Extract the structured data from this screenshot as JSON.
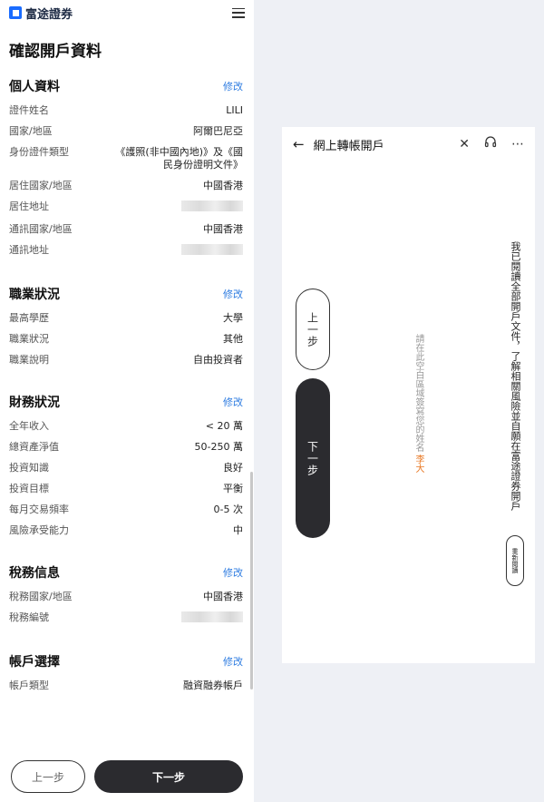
{
  "brand": {
    "logo_text": "富途證券"
  },
  "page_title": "確認開戶資料",
  "sections": [
    {
      "title": "個人資料",
      "edit": "修改",
      "rows": [
        {
          "k": "證件姓名",
          "v": "LILI"
        },
        {
          "k": "國家/地區",
          "v": "阿爾巴尼亞"
        },
        {
          "k": "身份證件類型",
          "v": "《護照(非中國內地)》及《國民身份證明文件》"
        },
        {
          "k": "居住國家/地區",
          "v": "中國香港"
        },
        {
          "k": "居住地址",
          "v": ""
        },
        {
          "k": "通訊國家/地區",
          "v": "中國香港"
        },
        {
          "k": "通訊地址",
          "v": ""
        }
      ]
    },
    {
      "title": "職業狀況",
      "edit": "修改",
      "rows": [
        {
          "k": "最高學歷",
          "v": "大學"
        },
        {
          "k": "職業狀況",
          "v": "其他"
        },
        {
          "k": "職業說明",
          "v": "自由投資者"
        }
      ]
    },
    {
      "title": "財務狀況",
      "edit": "修改",
      "rows": [
        {
          "k": "全年收入",
          "v": "< 20 萬"
        },
        {
          "k": "總資產淨值",
          "v": "50-250 萬"
        },
        {
          "k": "投資知識",
          "v": "良好"
        },
        {
          "k": "投資目標",
          "v": "平衡"
        },
        {
          "k": "每月交易頻率",
          "v": "0-5 次"
        },
        {
          "k": "風險承受能力",
          "v": "中"
        }
      ]
    },
    {
      "title": "稅務信息",
      "edit": "修改",
      "rows": [
        {
          "k": "稅務國家/地區",
          "v": "中國香港"
        },
        {
          "k": "稅務編號",
          "v": ""
        }
      ]
    },
    {
      "title": "帳戶選擇",
      "edit": "修改",
      "rows": [
        {
          "k": "帳戶類型",
          "v": "融資融券帳戶"
        }
      ]
    }
  ],
  "buttons": {
    "prev": "上一步",
    "next": "下一步"
  },
  "dialog": {
    "title": "網上轉帳開戶",
    "prev": "上一步",
    "next": "下一步",
    "sign_hint": "請在此空白區域簽寫您的姓名",
    "sign_name": "李大",
    "agree": "我已閱讀全部開戶文件，了解相關風險並自願在富途證券開戶",
    "reread": "重新閱讀"
  }
}
